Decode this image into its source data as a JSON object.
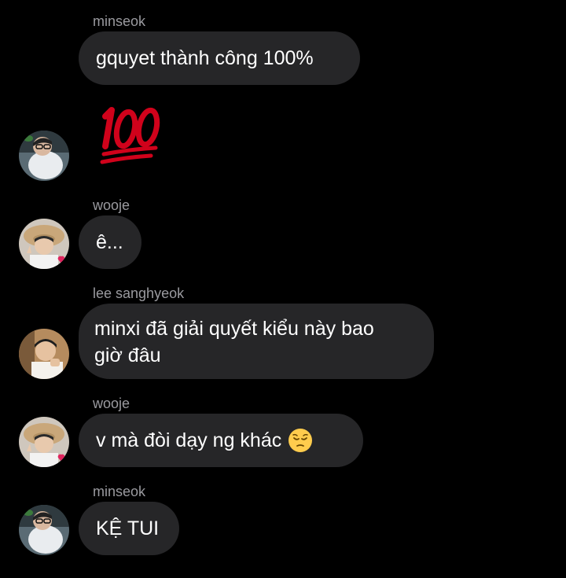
{
  "chat": {
    "messages": [
      {
        "sender": "minseok",
        "text": "gquyet thành công 100%"
      },
      {
        "sender": "",
        "emoji": "hundred-points"
      },
      {
        "sender": "wooje",
        "text": "ê..."
      },
      {
        "sender": "lee sanghyeok",
        "line1": "minxi đã giải quyết kiểu này bao",
        "line2": "giờ đâu"
      },
      {
        "sender": "wooje",
        "text": "v mà đòi dạy ng khác",
        "emoji": "pensive-face"
      },
      {
        "sender": "minseok",
        "text": "KỆ TUI"
      }
    ]
  },
  "colors": {
    "background": "#000000",
    "bubble": "#262628",
    "sender_name": "#9a9a9f",
    "hundred_red": "#d0021b"
  }
}
